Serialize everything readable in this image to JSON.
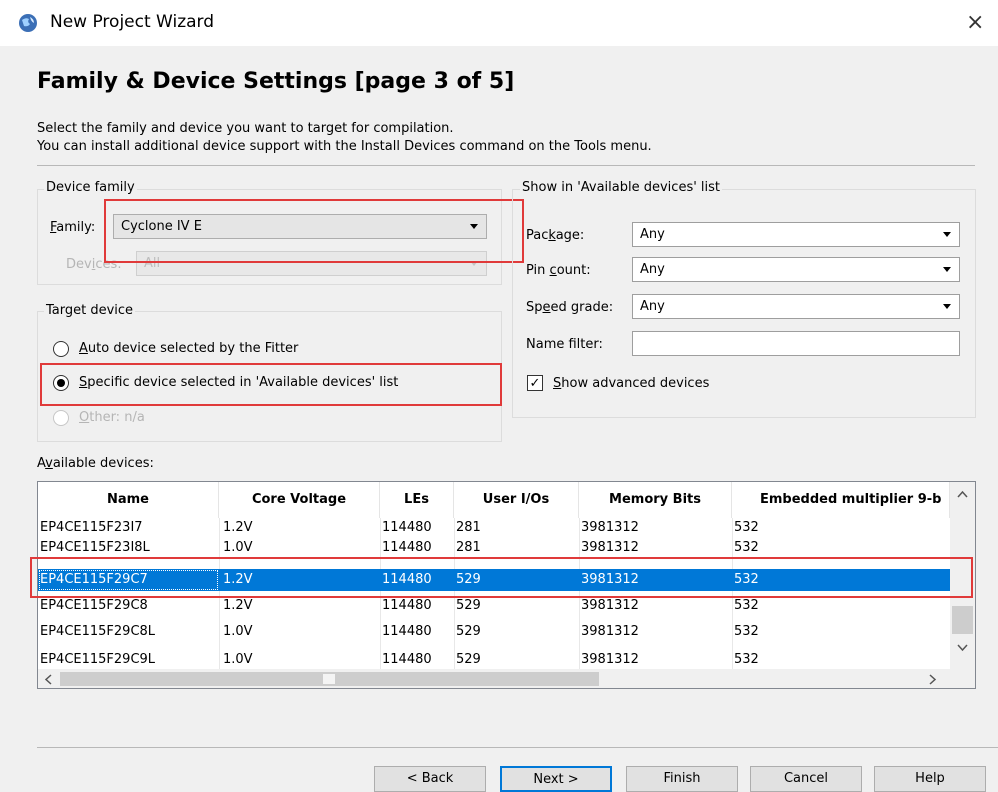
{
  "window": {
    "title": "New Project Wizard",
    "close_glyph": "×"
  },
  "page": {
    "heading": "Family & Device Settings [page 3 of 5]",
    "desc_line1": "Select the family and device you want to target for compilation.",
    "desc_line2": "You can install additional device support with the Install Devices command on the Tools menu."
  },
  "device_family": {
    "group_label": "Device family",
    "family_label_u": "F",
    "family_label_rest": "amily:",
    "family_value": "Cyclone IV E",
    "devices_label_a": "Dev",
    "devices_label_u": "i",
    "devices_label_b": "ces:",
    "devices_value": "All"
  },
  "target_device": {
    "group_label": "Target device",
    "auto_u": "A",
    "auto_rest": "uto device selected by the Fitter",
    "specific_u": "S",
    "specific_rest": "pecific device selected in 'Available devices' list",
    "other_u": "O",
    "other_rest": "ther:",
    "other_value": "n/a"
  },
  "show_list": {
    "group_label": "Show in 'Available devices' list",
    "package_a": "Pac",
    "package_u": "k",
    "package_b": "age:",
    "package_value": "Any",
    "pincount_a": "Pin ",
    "pincount_u": "c",
    "pincount_b": "ount:",
    "pincount_value": "Any",
    "speed_a": "Sp",
    "speed_u": "e",
    "speed_b": "ed grade:",
    "speed_value": "Any",
    "name_filter_label": "Name filter:",
    "name_filter_value": "",
    "advanced_u": "S",
    "advanced_rest": "how advanced devices",
    "advanced_checked": "✓"
  },
  "devices": {
    "label_a": "A",
    "label_u": "v",
    "label_b": "ailable devices:",
    "columns": [
      "Name",
      "Core Voltage",
      "LEs",
      "User I/Os",
      "Memory Bits",
      "Embedded multiplier 9-b"
    ],
    "rows": [
      [
        "EP4CE115F23I7",
        "1.2V",
        "114480",
        "281",
        "3981312",
        "532"
      ],
      [
        "EP4CE115F23I8L",
        "1.0V",
        "114480",
        "281",
        "3981312",
        "532"
      ],
      [
        "EP4CE115F29C7",
        "1.2V",
        "114480",
        "529",
        "3981312",
        "532"
      ],
      [
        "EP4CE115F29C8",
        "1.2V",
        "114480",
        "529",
        "3981312",
        "532"
      ],
      [
        "EP4CE115F29C8L",
        "1.0V",
        "114480",
        "529",
        "3981312",
        "532"
      ],
      [
        "EP4CE115F29C9L",
        "1.0V",
        "114480",
        "529",
        "3981312",
        "532"
      ]
    ],
    "selected_row": 2
  },
  "buttons": {
    "back": "< Back",
    "next": "Next >",
    "finish": "Finish",
    "cancel": "Cancel",
    "help": "Help"
  },
  "colors": {
    "selection": "#0078d7",
    "annotation_red": "#e03a3a"
  }
}
